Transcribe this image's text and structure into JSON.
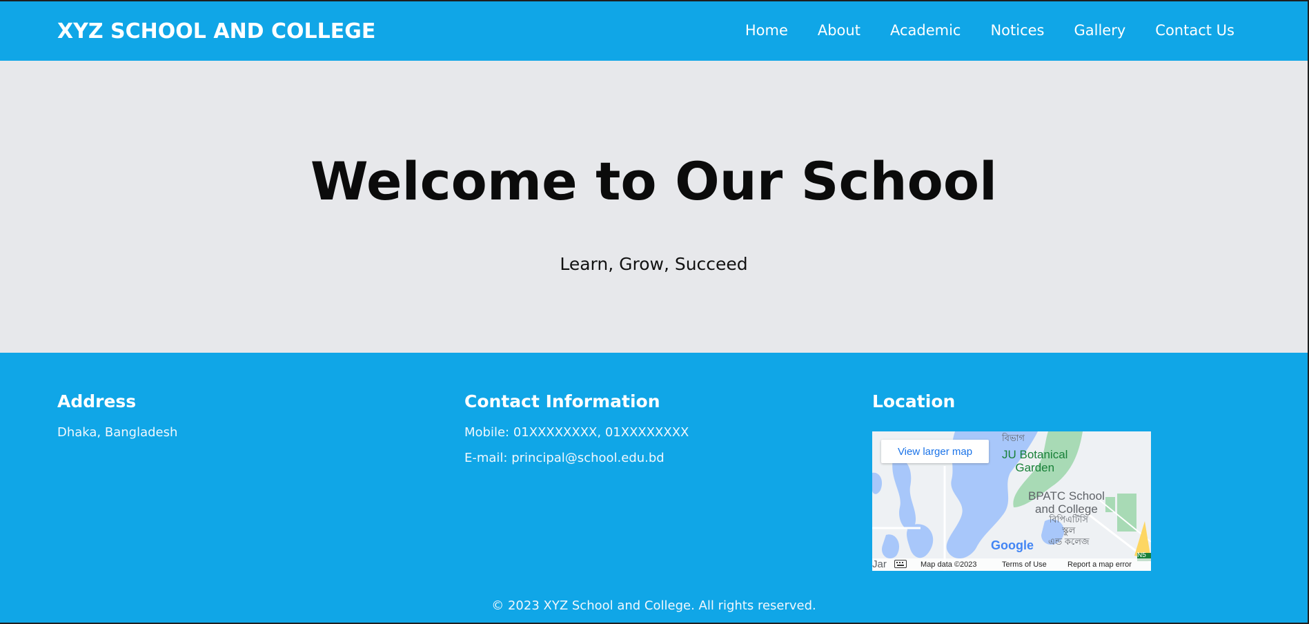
{
  "header": {
    "brand": "XYZ SCHOOL AND COLLEGE",
    "nav": [
      "Home",
      "About",
      "Academic",
      "Notices",
      "Gallery",
      "Contact Us"
    ]
  },
  "hero": {
    "title": "Welcome to Our School",
    "subtitle": "Learn, Grow, Succeed"
  },
  "footer": {
    "address": {
      "heading": "Address",
      "text": "Dhaka, Bangladesh"
    },
    "contact": {
      "heading": "Contact Information",
      "mobile": "Mobile:  01XXXXXXXX,  01XXXXXXXX",
      "email": "E-mail:  principal@school.edu.bd"
    },
    "location": {
      "heading": "Location",
      "map": {
        "button": "View larger map",
        "labels": {
          "garden": "JU Botanical\nGarden",
          "school": "BPATC School\nand College",
          "bn_school": "বিপিএটিসি\nস্কুল\nএন্ড কলেজ",
          "bn_top": "বিভাগ"
        },
        "google": "Google",
        "data": "Map data ©2023",
        "terms": "Terms of Use",
        "report": "Report a map error",
        "road": "N5",
        "partial": "Jar"
      }
    },
    "copyright": "© 2023 XYZ School and College. All rights reserved."
  },
  "colors": {
    "primary": "#10a6e7",
    "hero_bg": "#e7e8eb",
    "text_dark": "#0b0b0b",
    "white": "#ffffff"
  }
}
